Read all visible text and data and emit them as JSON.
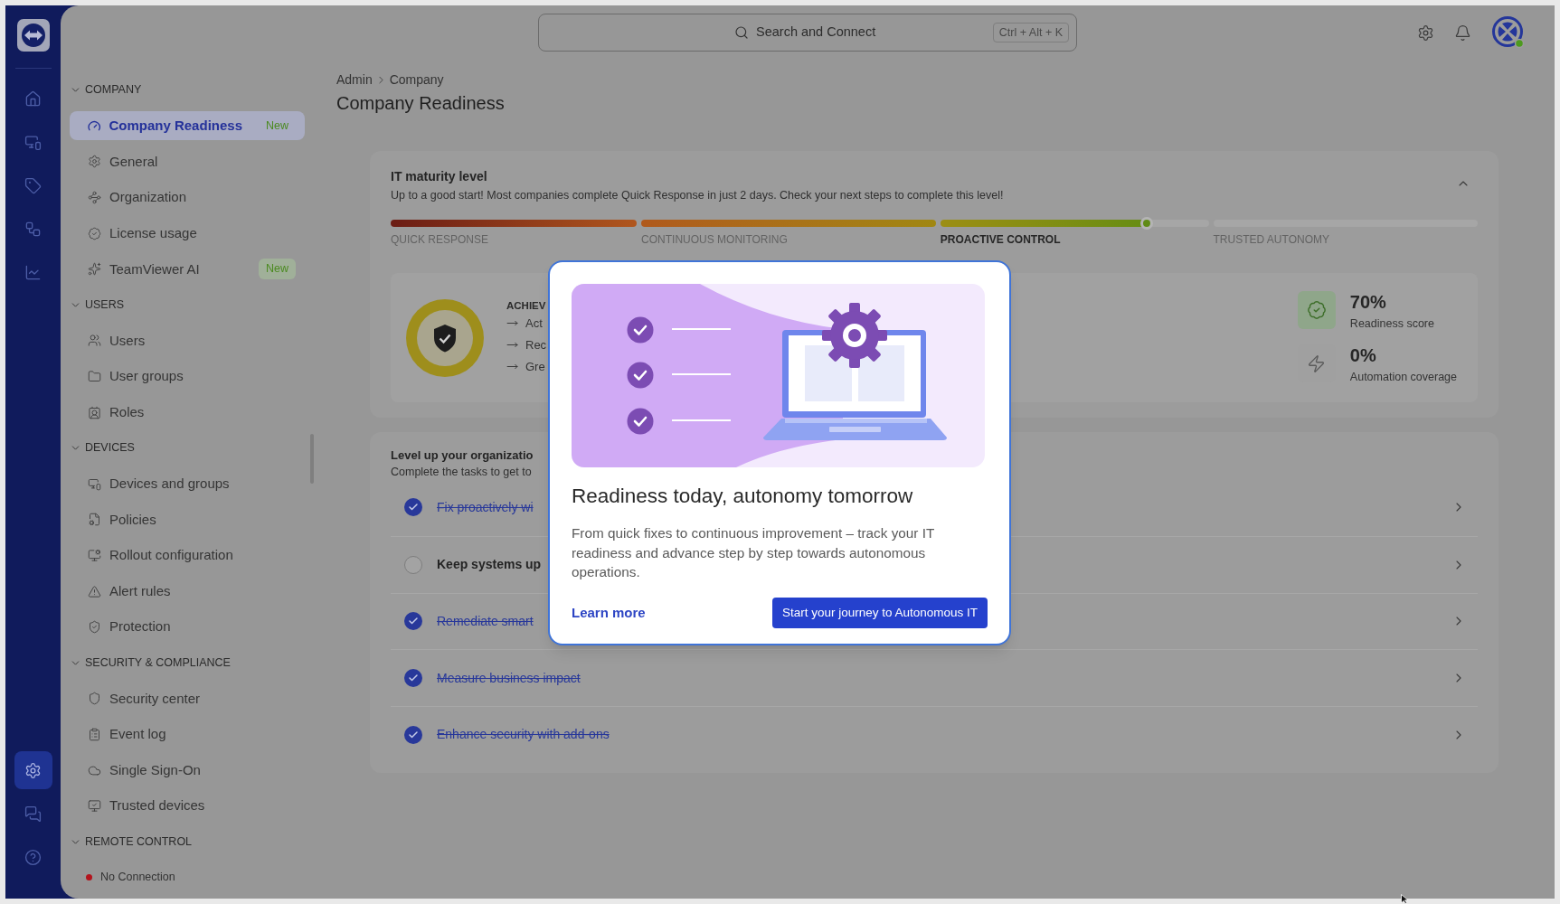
{
  "rail": {
    "top_items": [
      {
        "selected": false
      },
      {
        "selected": false
      },
      {
        "selected": false
      },
      {
        "selected": false
      },
      {
        "selected": false
      }
    ],
    "bottom_items": [
      {
        "selected": true
      },
      {
        "selected": false
      },
      {
        "selected": false
      }
    ]
  },
  "top_bar": {
    "search": {
      "placeholder": "Search and Connect",
      "shortcut": "Ctrl + Alt + K"
    }
  },
  "sidebar": {
    "sections": [
      {
        "title": "COMPANY",
        "expanded": true,
        "items": [
          {
            "kind": "link",
            "label": "Company Readiness",
            "selected": true,
            "badge": "New"
          },
          {
            "kind": "link",
            "label": "General",
            "selected": false
          },
          {
            "kind": "link",
            "label": "Organization",
            "selected": false
          },
          {
            "kind": "link",
            "label": "License usage",
            "selected": false
          },
          {
            "kind": "link",
            "label": "TeamViewer AI",
            "selected": false,
            "badge": "New"
          }
        ]
      },
      {
        "title": "USERS",
        "expanded": true,
        "items": [
          {
            "kind": "link",
            "label": "Users",
            "selected": false
          },
          {
            "kind": "link",
            "label": "User groups",
            "selected": false
          },
          {
            "kind": "link",
            "label": "Roles",
            "selected": false
          }
        ]
      },
      {
        "title": "DEVICES",
        "expanded": true,
        "items": [
          {
            "kind": "link",
            "label": "Devices and groups",
            "selected": false
          },
          {
            "kind": "link",
            "label": "Policies",
            "selected": false
          },
          {
            "kind": "link",
            "label": "Rollout configuration",
            "selected": false
          },
          {
            "kind": "link",
            "label": "Alert rules",
            "selected": false
          },
          {
            "kind": "link",
            "label": "Protection",
            "selected": false
          }
        ]
      },
      {
        "title": "SECURITY & COMPLIANCE",
        "expanded": true,
        "items": [
          {
            "kind": "link",
            "label": "Security center",
            "selected": false
          },
          {
            "kind": "link",
            "label": "Event log",
            "selected": false
          },
          {
            "kind": "link",
            "label": "Single Sign-On",
            "selected": false
          },
          {
            "kind": "link",
            "label": "Trusted devices",
            "selected": false
          }
        ]
      },
      {
        "title": "REMOTE CONTROL",
        "expanded": true,
        "items": [
          {
            "kind": "status",
            "label": "No Connection"
          }
        ]
      }
    ]
  },
  "page": {
    "breadcrumb": [
      "Admin",
      "Company"
    ],
    "title": "Company Readiness"
  },
  "maturity_card": {
    "title": "IT maturity level",
    "subtitle": "Up to a good start! Most companies complete Quick Response in just 2 days. Check your next steps to complete this level!",
    "expanded": true,
    "levels": [
      {
        "label": "QUICK RESPONSE",
        "level": 1,
        "selected": false
      },
      {
        "label": "CONTINUOUS MONITORING",
        "level": 1,
        "selected": false
      },
      {
        "label": "PROACTIVE CONTROL",
        "level": 0.77,
        "selected": true
      },
      {
        "label": "TRUSTED AUTONOMY",
        "selected": false
      }
    ],
    "achievements": {
      "title": "ACHIEV",
      "items": [
        "Act",
        "Rec",
        "Gre"
      ]
    },
    "stats": [
      {
        "kind": "readiness",
        "value": "70%",
        "label": "Readiness score"
      },
      {
        "kind": "automation",
        "value": "0%",
        "label": "Automation coverage"
      }
    ]
  },
  "tasks_card": {
    "title": "Level up your organizatio",
    "subtitle": "Complete the tasks to get to",
    "items": [
      {
        "label": "Fix proactively wi",
        "done": true
      },
      {
        "label": "Keep systems up",
        "done": false
      },
      {
        "label": "Remediate smart",
        "done": true
      },
      {
        "label": "Measure business impact",
        "done": true
      },
      {
        "label": "Enhance security with add-ons",
        "done": true
      }
    ]
  },
  "dialog": {
    "title": "Readiness today, autonomy tomorrow",
    "body": "From quick fixes to continuous improvement – track your IT readiness and advance step by step towards autonomous operations.",
    "link": "Learn more",
    "button": "Start your journey to Autonomous IT"
  }
}
